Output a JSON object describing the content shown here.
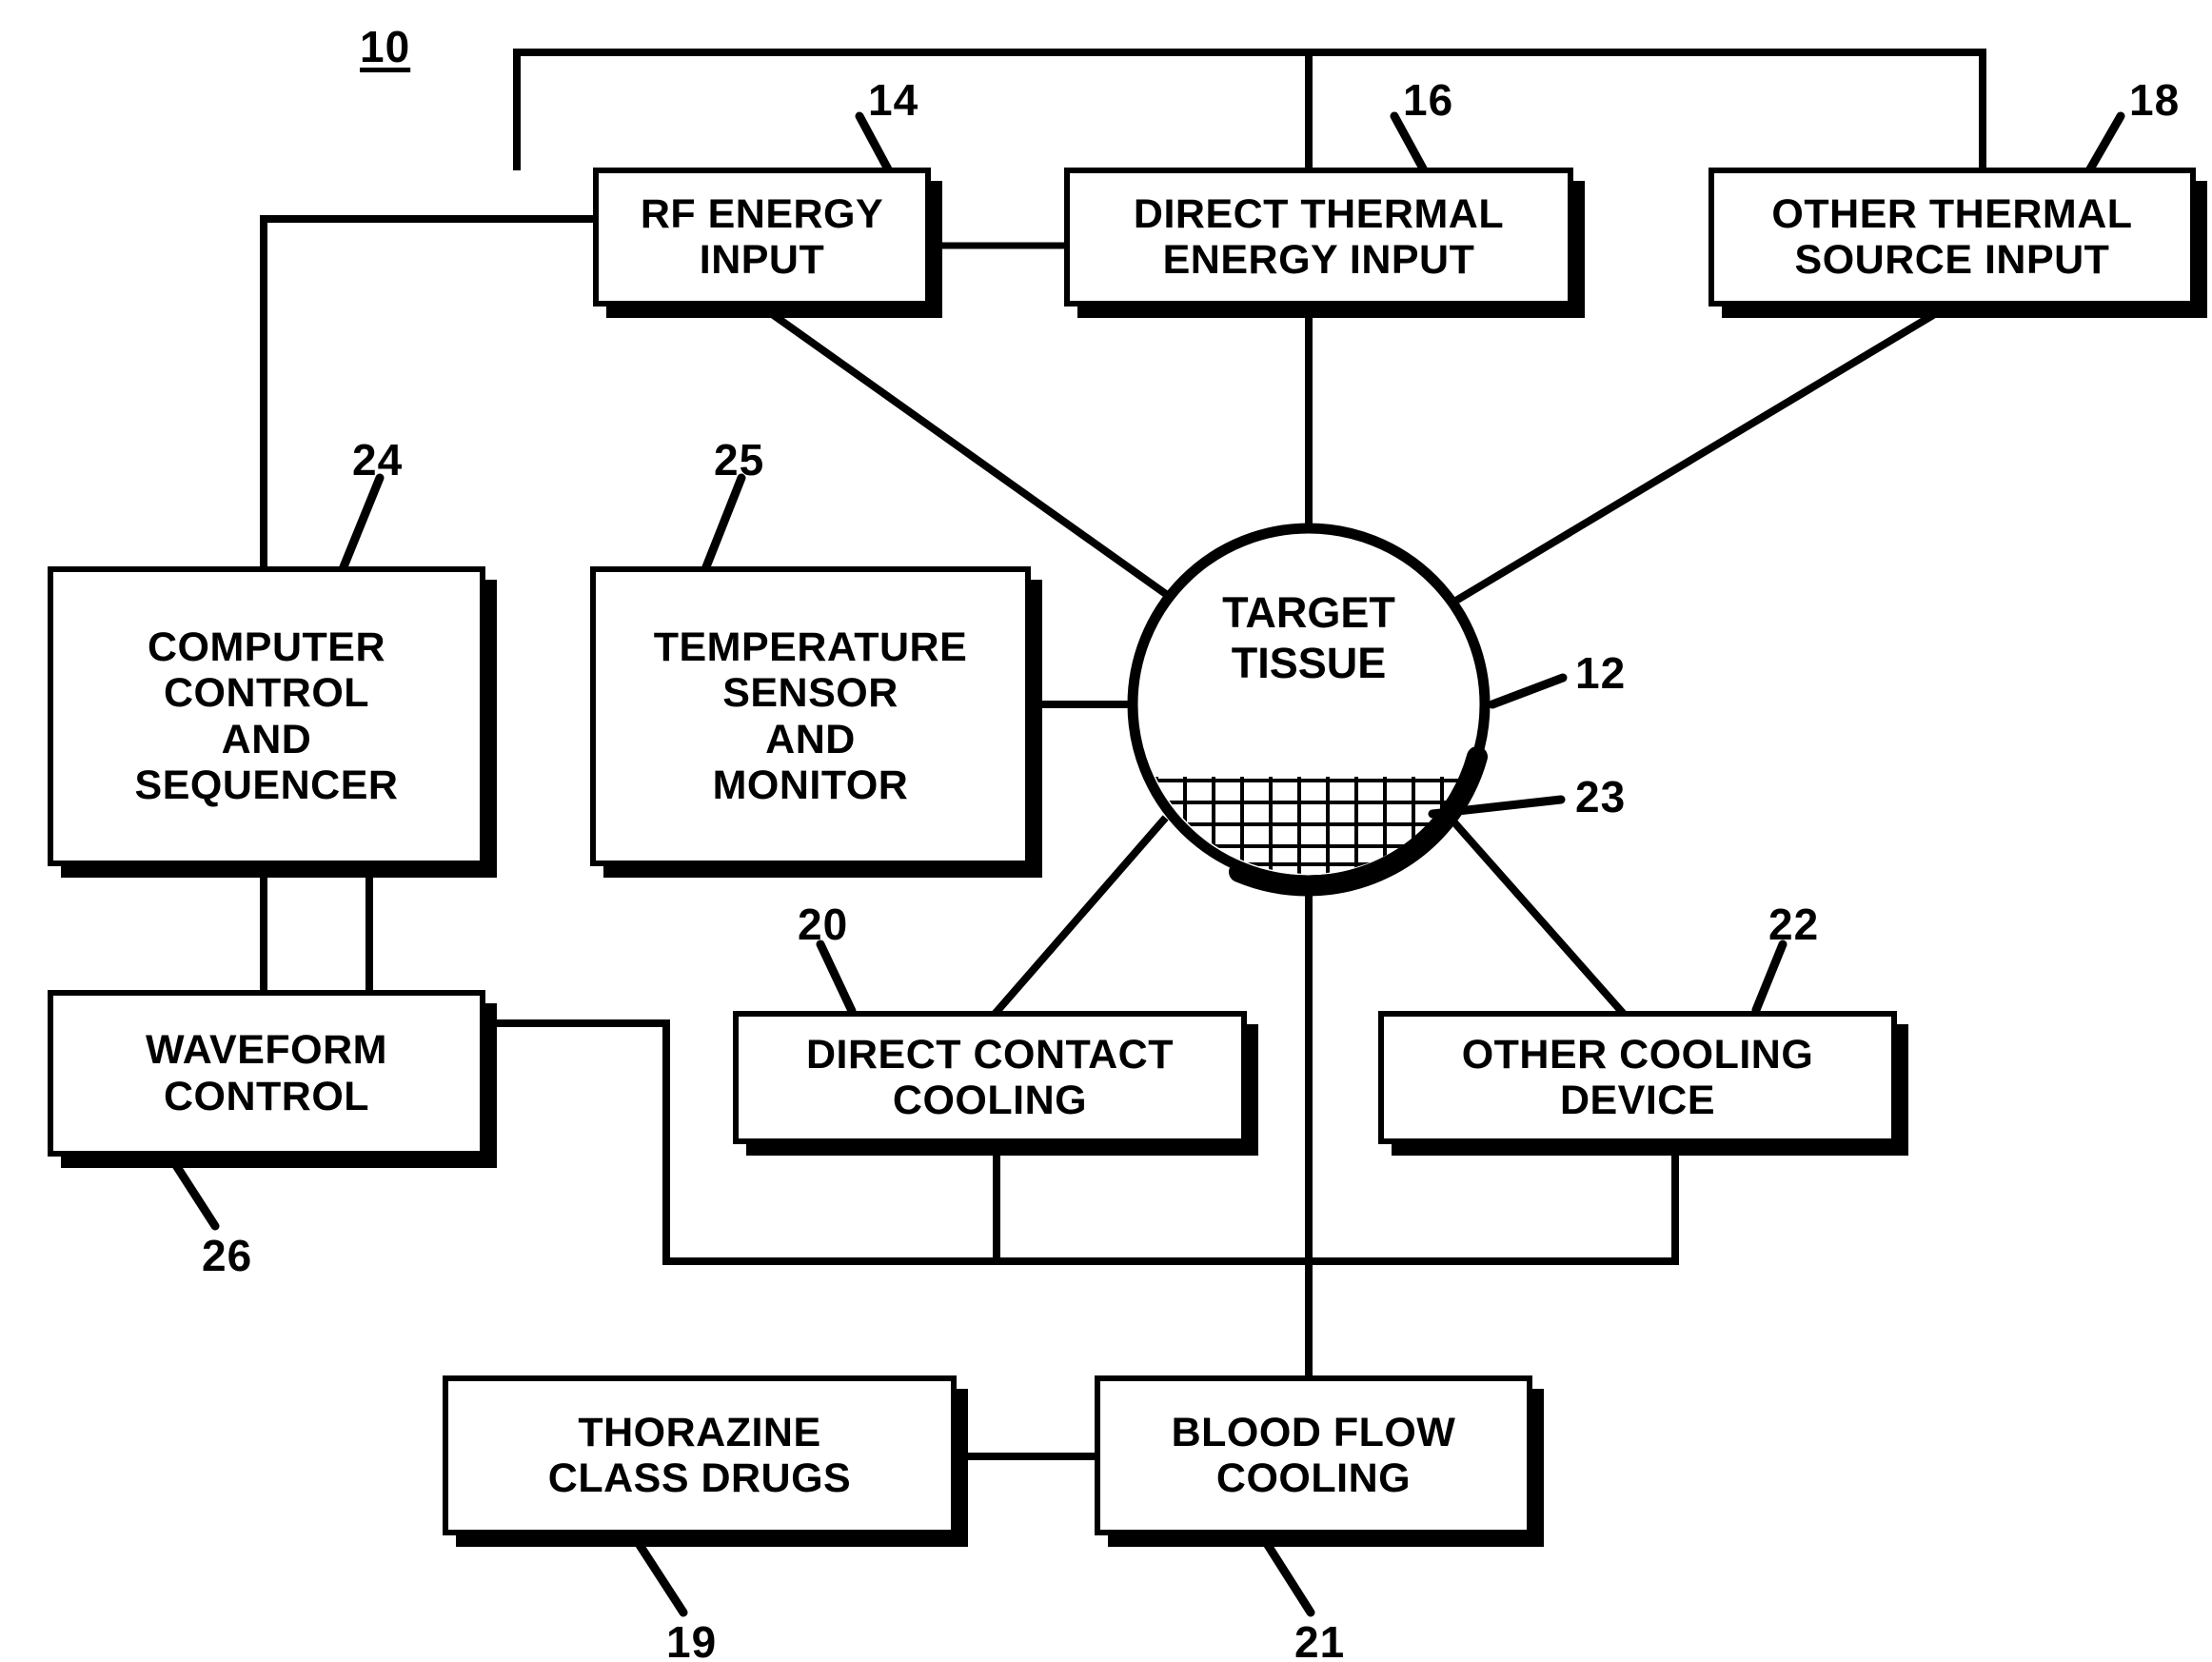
{
  "figure": {
    "main_ref": "10",
    "nodes": [
      {
        "id": "rf_energy_input",
        "ref": "14",
        "lines": [
          "RF ENERGY",
          "INPUT"
        ]
      },
      {
        "id": "direct_thermal_input",
        "ref": "16",
        "lines": [
          "DIRECT THERMAL",
          "ENERGY INPUT"
        ]
      },
      {
        "id": "other_thermal_input",
        "ref": "18",
        "lines": [
          "OTHER THERMAL",
          "SOURCE INPUT"
        ]
      },
      {
        "id": "computer_control",
        "ref": "24",
        "lines": [
          "COMPUTER",
          "CONTROL",
          "AND",
          "SEQUENCER"
        ]
      },
      {
        "id": "temperature_sensor",
        "ref": "25",
        "lines": [
          "TEMPERATURE",
          "SENSOR",
          "AND",
          "MONITOR"
        ]
      },
      {
        "id": "target_tissue",
        "ref": "12",
        "lines": [
          "TARGET",
          "TISSUE"
        ]
      },
      {
        "id": "lesion_region",
        "ref": "23",
        "lines": []
      },
      {
        "id": "waveform_control",
        "ref": "26",
        "lines": [
          "WAVEFORM",
          "CONTROL"
        ]
      },
      {
        "id": "direct_contact_cooling",
        "ref": "20",
        "lines": [
          "DIRECT CONTACT",
          "COOLING"
        ]
      },
      {
        "id": "other_cooling_device",
        "ref": "22",
        "lines": [
          "OTHER COOLING",
          "DEVICE"
        ]
      },
      {
        "id": "thorazine_drugs",
        "ref": "19",
        "lines": [
          "THORAZINE",
          "CLASS DRUGS"
        ]
      },
      {
        "id": "blood_flow_cooling",
        "ref": "21",
        "lines": [
          "BLOOD FLOW",
          "COOLING"
        ]
      }
    ],
    "colors": {
      "ink": "#000000",
      "paper": "#ffffff"
    }
  }
}
